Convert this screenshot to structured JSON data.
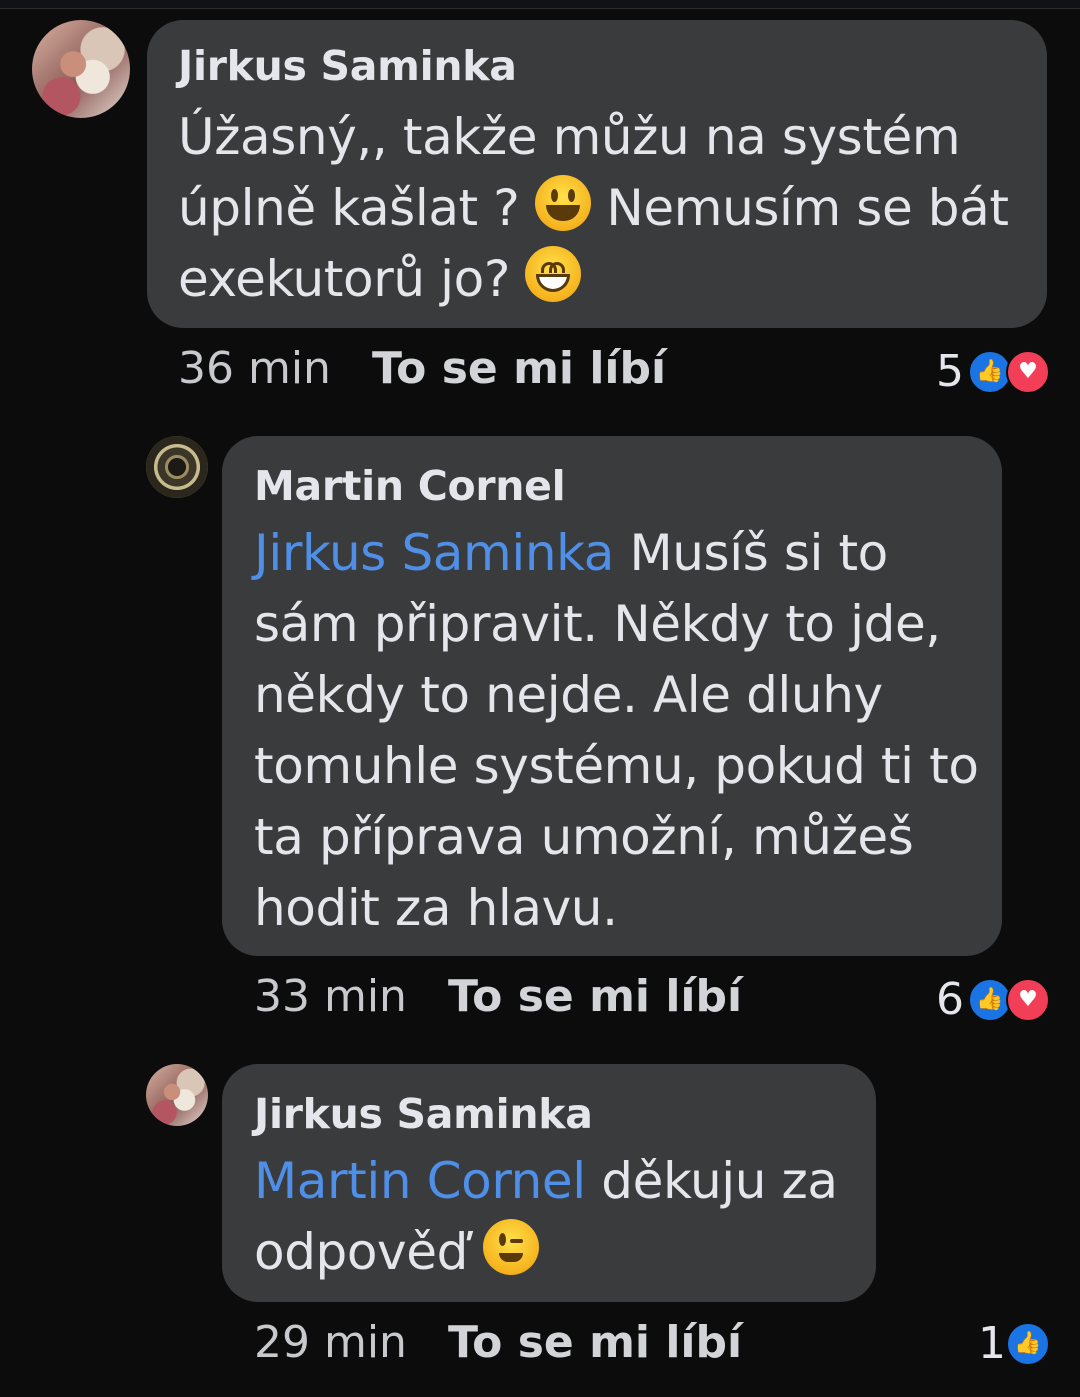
{
  "comments": [
    {
      "author": "Jirkus Saminka",
      "lines": [
        {
          "text": "Úžasný,, takže můžu na systém"
        },
        {
          "text": "úplně kašlat ? ",
          "emoji": "smiley-emoji",
          "after": " Nemusím se bát"
        },
        {
          "text": "exekutorů jo? ",
          "emoji": "grin-emoji"
        }
      ],
      "time": "36 min",
      "like_label": "To se mi líbí",
      "reaction_count": "5",
      "reactions": [
        "like-icon",
        "heart-icon"
      ]
    },
    {
      "author": "Martin Cornel",
      "mention": "Jirkus Saminka",
      "lines": [
        {
          "text": " Musíš si to"
        },
        {
          "text": "sám připravit. Někdy to jde,"
        },
        {
          "text": "někdy to nejde. Ale dluhy"
        },
        {
          "text": "tomuhle systému, pokud ti to"
        },
        {
          "text": "ta příprava umožní, můžeš"
        },
        {
          "text": "hodit za hlavu."
        }
      ],
      "time": "33 min",
      "like_label": "To se mi líbí",
      "reaction_count": "6",
      "reactions": [
        "like-icon",
        "heart-icon"
      ]
    },
    {
      "author": "Jirkus Saminka",
      "mention": "Martin Cornel",
      "lines": [
        {
          "text": " děkuju za"
        },
        {
          "text": "odpověď ",
          "emoji": "wink-emoji"
        }
      ],
      "time": "29 min",
      "like_label": "To se mi líbí",
      "reaction_count": "1",
      "reactions": [
        "like-icon"
      ]
    }
  ],
  "colors": {
    "background": "#0c0c0d",
    "bubble": "#3a3b3c",
    "mention": "#4f8fe8",
    "like": "#1b74e4",
    "love": "#f33e58"
  }
}
